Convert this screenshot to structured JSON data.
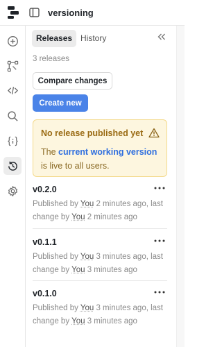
{
  "app": {
    "title": "versioning"
  },
  "tabs": [
    {
      "label": "Releases",
      "active": true
    },
    {
      "label": "History",
      "active": false
    }
  ],
  "release_count": "3 releases",
  "buttons": {
    "compare": "Compare changes",
    "create": "Create new"
  },
  "notice": {
    "title": "No release published yet",
    "body_pre": "The",
    "body_link": "current working version",
    "body_post": "is live to all users."
  },
  "releases": [
    {
      "version": "v0.2.0",
      "pub_prefix": "Published by",
      "pub_user": "You",
      "pub_time": "2 minutes ago, last change by",
      "change_user": "You",
      "change_time": "2 minutes ago"
    },
    {
      "version": "v0.1.1",
      "pub_prefix": "Published by",
      "pub_user": "You",
      "pub_time": "3 minutes ago, last change by",
      "change_user": "You",
      "change_time": "3 minutes ago"
    },
    {
      "version": "v0.1.0",
      "pub_prefix": "Published by",
      "pub_user": "You",
      "pub_time": "3 minutes ago, last change by",
      "change_user": "You",
      "change_time": "3 minutes ago"
    }
  ],
  "rail_icons": [
    "plus-circle-icon",
    "flow-icon",
    "code-icon",
    "search-icon",
    "variables-icon",
    "history-icon",
    "settings-icon"
  ],
  "colors": {
    "primary": "#4a83e8",
    "warning_bg": "#fdf6df",
    "warning_text": "#9a6b14",
    "link": "#2f6fdf"
  }
}
